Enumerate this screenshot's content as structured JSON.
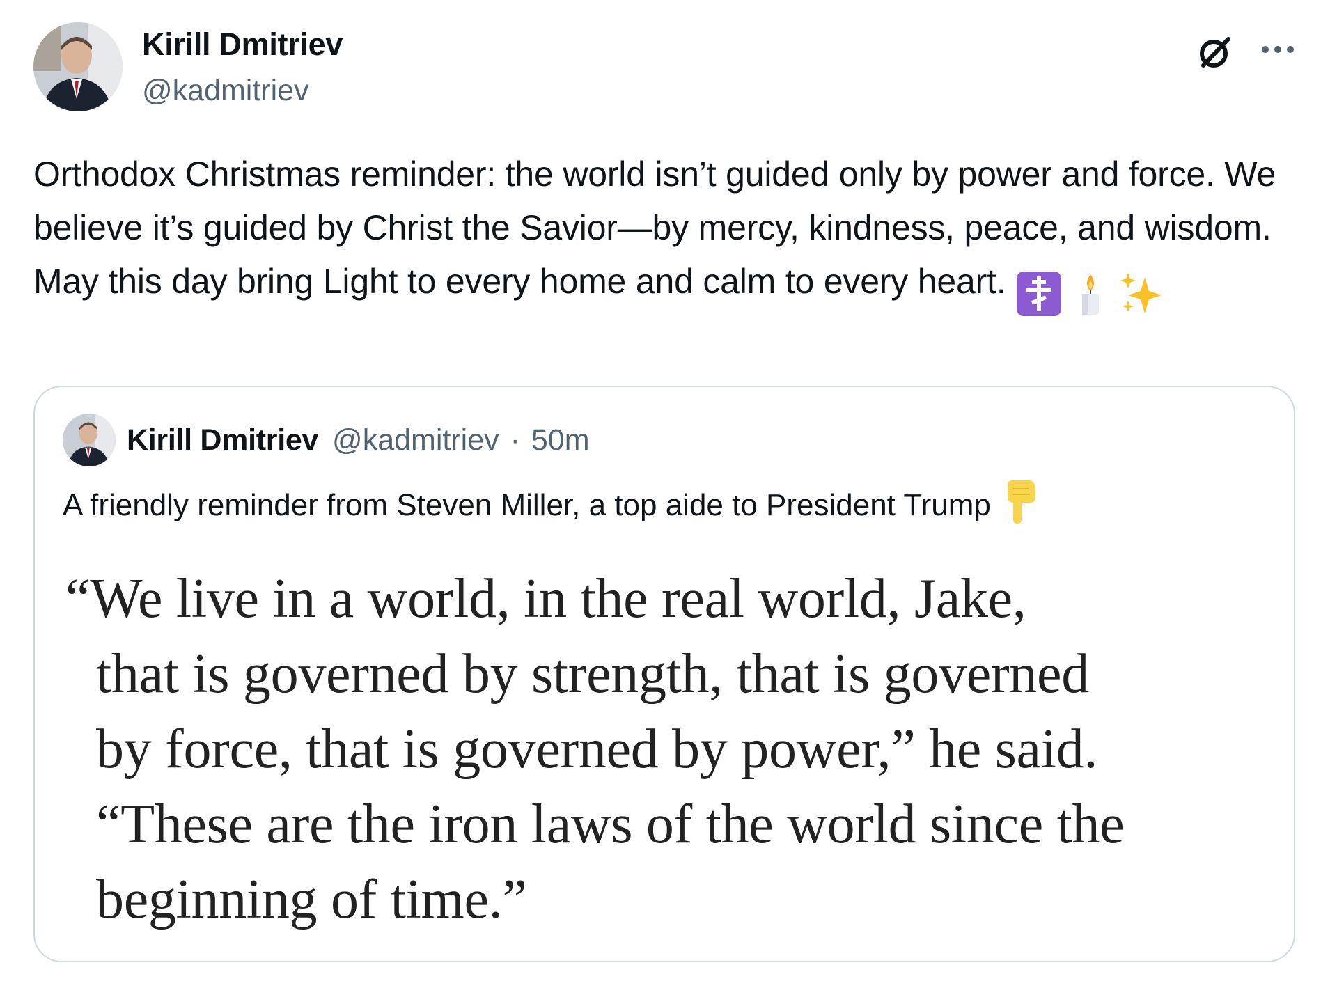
{
  "post": {
    "author": {
      "name": "Kirill Dmitriev",
      "handle": "@kadmitriev",
      "avatar_icon": "profile-photo"
    },
    "header_icons": [
      "grok-icon",
      "more-icon"
    ],
    "text": "Orthodox Christmas reminder: the world isn’t guided only by power and force. We believe it’s guided by Christ the Savior—by mercy, kindness, peace, and wisdom. May this day bring Light to every home and calm to every heart.",
    "emojis": [
      "orthodox-cross-emoji",
      "candle-emoji",
      "sparkles-emoji"
    ]
  },
  "quoted_post": {
    "author": {
      "name": "Kirill Dmitriev",
      "handle": "@kadmitriev",
      "separator": "·",
      "time": "50m"
    },
    "text": "A friendly reminder from Steven Miller, a top aide to President Trump",
    "trailing_emoji": "backhand-index-pointing-down-emoji",
    "image_quote_lines": [
      "“We live in a world, in the real world, Jake,",
      "that is governed by strength, that is governed",
      "by force, that is governed by power,” he said.",
      "“These are the iron laws of the world since the",
      "beginning of time.”"
    ]
  },
  "colors": {
    "text_primary": "#0f1419",
    "text_secondary": "#536471",
    "card_border": "#cfd9de",
    "quote_text": "#222222"
  }
}
